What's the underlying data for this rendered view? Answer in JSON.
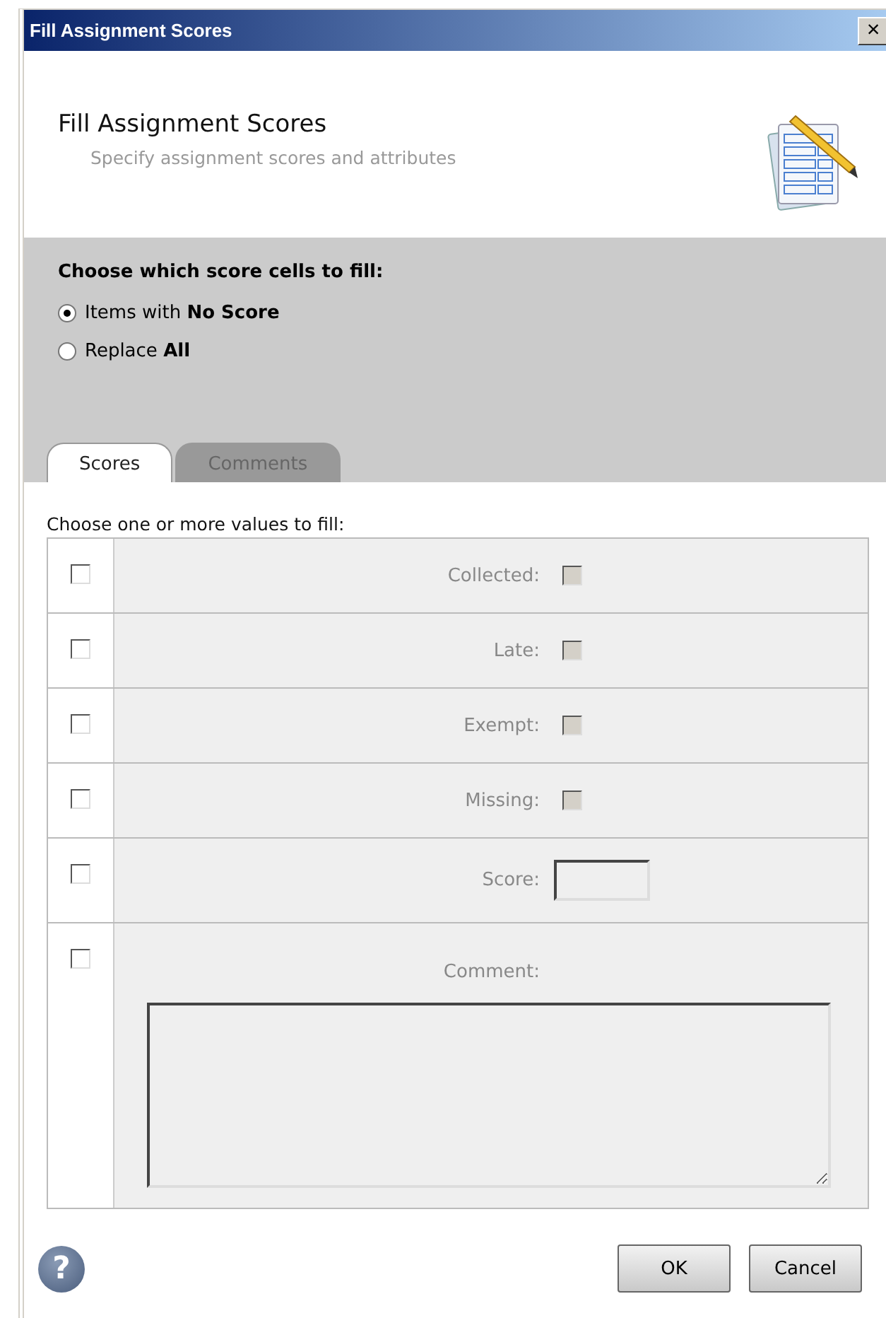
{
  "window": {
    "title": "Fill Assignment Scores",
    "close": "×"
  },
  "header": {
    "title": "Fill Assignment Scores",
    "subtitle": "Specify assignment scores and attributes"
  },
  "fill_mode": {
    "label": "Choose which score cells to fill:",
    "options": [
      {
        "label": "Items with **No Score**",
        "selected": true
      },
      {
        "label": "Replace **All**",
        "selected": false
      }
    ]
  },
  "tabs": [
    {
      "label": "Scores",
      "selected": true
    },
    {
      "label": "Comments",
      "selected": false
    }
  ],
  "values": {
    "label": "Choose one or more values to fill:",
    "rows": [
      {
        "kind": "checkbox",
        "enabled": false,
        "label": "Collected:",
        "checked": false
      },
      {
        "kind": "checkbox",
        "enabled": false,
        "label": "Late:",
        "checked": false
      },
      {
        "kind": "checkbox",
        "enabled": false,
        "label": "Exempt:",
        "checked": false
      },
      {
        "kind": "checkbox",
        "enabled": false,
        "label": "Missing:",
        "checked": false
      },
      {
        "kind": "text",
        "enabled": false,
        "label": "Score:"
      },
      {
        "kind": "textarea",
        "enabled": false,
        "label": "Comment:"
      }
    ]
  },
  "footer": {
    "help": "?",
    "buttons": [
      "OK",
      "Cancel"
    ]
  }
}
